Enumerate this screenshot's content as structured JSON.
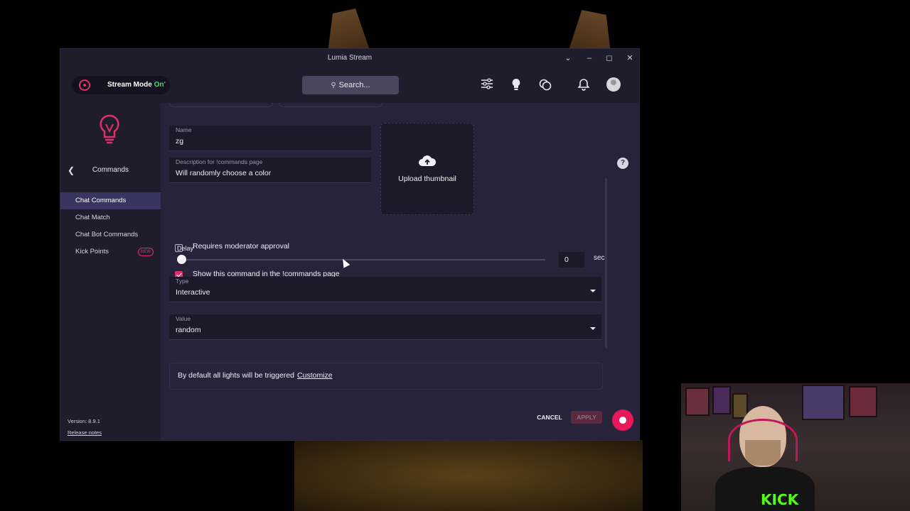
{
  "window": {
    "title": "Lumia Stream"
  },
  "topbar": {
    "stream_mode_label": "Stream Mode",
    "stream_mode_state": "On",
    "stream_mode_suffix": "'",
    "search_placeholder": "Search..."
  },
  "sidebar": {
    "section_title": "Commands",
    "items": [
      {
        "label": "Chat Commands",
        "active": true
      },
      {
        "label": "Chat Match",
        "active": false
      },
      {
        "label": "Chat Bot Commands",
        "active": false
      },
      {
        "label": "Kick Points",
        "active": false,
        "badge": "NEW"
      }
    ],
    "version": "Version: 8.9.1",
    "release_notes": "Release notes"
  },
  "form": {
    "name_label": "Name",
    "name_value": "zg",
    "description_label": "Description for !commands page",
    "description_value": "Will randomly choose a color",
    "upload_label": "Upload thumbnail",
    "moderator_label": "Requires moderator approval",
    "moderator_checked": false,
    "show_label_prefix": "Show this command in the ",
    "show_label_link": "!commands page",
    "show_checked": true,
    "delay_label": "Delay",
    "delay_value": "0",
    "delay_unit": "sec",
    "delay_fraction": 0,
    "type_label": "Type",
    "type_value": "Interactive",
    "value_label": "Value",
    "value_value": "random",
    "info_text": "By default all lights will be triggered",
    "info_link": "Customize"
  },
  "footer": {
    "cancel_label": "CANCEL",
    "apply_label": "APPLY"
  },
  "colors": {
    "accent": "#e0306a",
    "stream_on": "#3ee06a",
    "active_nav": "#3a3560"
  }
}
